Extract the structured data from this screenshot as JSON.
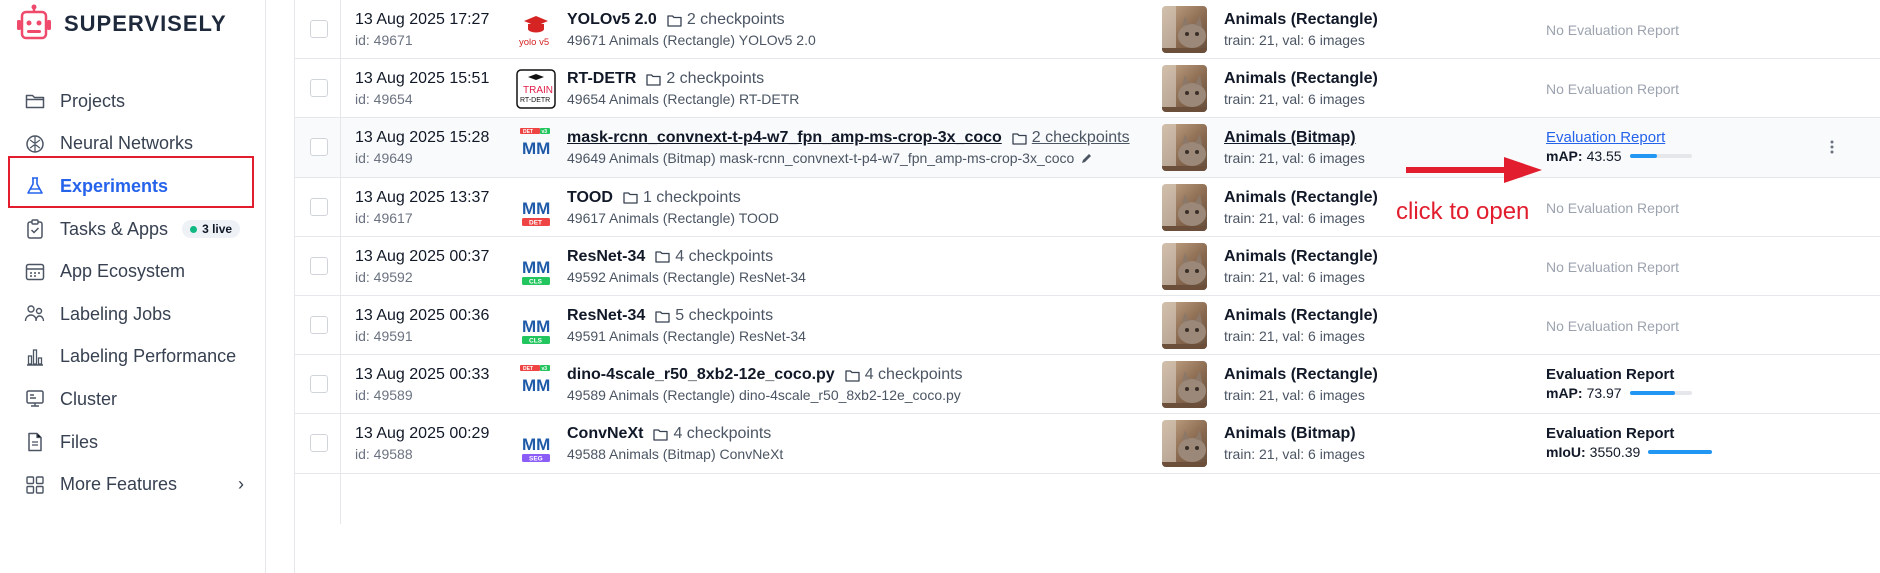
{
  "brand": {
    "name": "SUPERVISELY"
  },
  "sidebar": {
    "items": [
      {
        "label": "Projects",
        "icon": "folder-icon"
      },
      {
        "label": "Neural Networks",
        "icon": "brain-icon"
      },
      {
        "label": "Experiments",
        "icon": "flask-icon",
        "active": true
      },
      {
        "label": "Tasks & Apps",
        "icon": "clipboard-icon",
        "badge": "3 live"
      },
      {
        "label": "App Ecosystem",
        "icon": "app-window-icon"
      },
      {
        "label": "Labeling Jobs",
        "icon": "users-icon"
      },
      {
        "label": "Labeling Performance",
        "icon": "bar-chart-icon"
      },
      {
        "label": "Cluster",
        "icon": "server-icon"
      },
      {
        "label": "Files",
        "icon": "file-icon"
      },
      {
        "label": "More Features",
        "icon": "grid-icon",
        "chevron": "›"
      }
    ]
  },
  "experiments": [
    {
      "date": "13 Aug 2025 17:27",
      "id": "id: 49671",
      "framework": "yolo-v5-icon",
      "name": "YOLOv5 2.0",
      "checkpoints": "2 checkpoints",
      "subtitle": "49671 Animals (Rectangle) YOLOv5 2.0",
      "project": "Animals (Rectangle)",
      "project_stats": "train: 21,  val: 6 images",
      "eval": "No Evaluation Report"
    },
    {
      "date": "13 Aug 2025 15:51",
      "id": "id: 49654",
      "framework": "rt-detr-icon",
      "name": "RT-DETR",
      "checkpoints": "2 checkpoints",
      "subtitle": "49654 Animals (Rectangle) RT-DETR",
      "project": "Animals (Rectangle)",
      "project_stats": "train: 21,  val: 6 images",
      "eval": "No Evaluation Report"
    },
    {
      "date": "13 Aug 2025 15:28",
      "id": "id: 49649",
      "framework": "mmdet-v3-icon",
      "name": "mask-rcnn_convnext-t-p4-w7_fpn_amp-ms-crop-3x_coco",
      "checkpoints": "2 checkpoints",
      "subtitle": "49649 Animals (Bitmap) mask-rcnn_convnext-t-p4-w7_fpn_amp-ms-crop-3x_coco",
      "project": "Animals (Bitmap)",
      "project_stats": "train: 21,  val: 6 images",
      "eval": "Evaluation Report",
      "metric_label": "mAP:",
      "metric_value": "43.55",
      "metric_fraction": 0.4355
    },
    {
      "date": "13 Aug 2025 13:37",
      "id": "id: 49617",
      "framework": "mmdet-icon",
      "name": "TOOD",
      "checkpoints": "1 checkpoints",
      "subtitle": "49617 Animals (Rectangle) TOOD",
      "project": "Animals (Rectangle)",
      "project_stats": "train: 21,  val: 6 images",
      "eval": "No Evaluation Report"
    },
    {
      "date": "13 Aug 2025 00:37",
      "id": "id: 49592",
      "framework": "mmcls-icon",
      "name": "ResNet-34",
      "checkpoints": "4 checkpoints",
      "subtitle": "49592 Animals (Rectangle) ResNet-34",
      "project": "Animals (Rectangle)",
      "project_stats": "train: 21,  val: 6 images",
      "eval": "No Evaluation Report"
    },
    {
      "date": "13 Aug 2025 00:36",
      "id": "id: 49591",
      "framework": "mmcls-icon",
      "name": "ResNet-34",
      "checkpoints": "5 checkpoints",
      "subtitle": "49591 Animals (Rectangle) ResNet-34",
      "project": "Animals (Rectangle)",
      "project_stats": "train: 21,  val: 6 images",
      "eval": "No Evaluation Report"
    },
    {
      "date": "13 Aug 2025 00:33",
      "id": "id: 49589",
      "framework": "mmdet-v3-icon",
      "name": "dino-4scale_r50_8xb2-12e_coco.py",
      "checkpoints": "4 checkpoints",
      "subtitle": "49589 Animals (Rectangle) dino-4scale_r50_8xb2-12e_coco.py",
      "project": "Animals (Rectangle)",
      "project_stats": "train: 21,  val: 6 images",
      "eval": "Evaluation Report",
      "metric_label": "mAP:",
      "metric_value": "73.97",
      "metric_fraction": 0.7397
    },
    {
      "date": "13 Aug 2025 00:29",
      "id": "id: 49588",
      "framework": "mmseg-icon",
      "name": "ConvNeXt",
      "checkpoints": "4 checkpoints",
      "subtitle": "49588 Animals (Bitmap) ConvNeXt",
      "project": "Animals (Bitmap)",
      "project_stats": "train: 21,  val: 6 images",
      "eval": "Evaluation Report",
      "metric_label": "mIoU:",
      "metric_value": "3550.39",
      "metric_fraction": 1.0
    }
  ],
  "framework_labels": {
    "yolo": "yolo v5",
    "train": "TRAIN",
    "rtdetr": "RT-DETR",
    "mm": "MM",
    "det": "DET",
    "cls": "CLS",
    "seg": "SEG",
    "v3": "v3"
  },
  "annotation": {
    "text": "click to open",
    "color": "#e11d2e"
  },
  "colors": {
    "accent": "#2563eb",
    "progress": "#2196f3",
    "highlight_box": "#e11d2e"
  }
}
